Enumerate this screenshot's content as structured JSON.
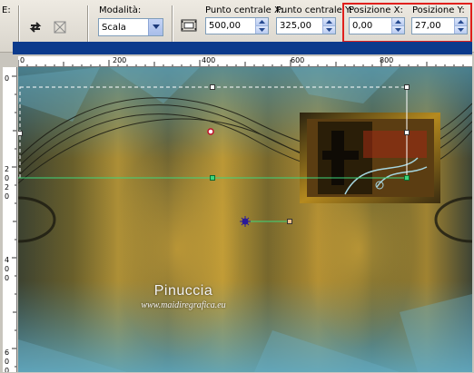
{
  "toolbar": {
    "cut_label": "E:",
    "mode_label": "Modalità:",
    "mode_value": "Scala",
    "center_x_label": "Punto centrale X:",
    "center_x_value": "500,00",
    "center_y_label": "Punto centrale Y:",
    "center_y_value": "325,00",
    "pos_x_label": "Posizione X:",
    "pos_x_value": "0,00",
    "pos_y_label": "Posizione Y:",
    "pos_y_value": "27,00",
    "highlight_color": "#e0201c"
  },
  "rulers": {
    "top": [
      "0",
      "200",
      "400",
      "600",
      "800"
    ],
    "left": [
      "0",
      "2",
      "0",
      "2",
      "0",
      "4",
      "0",
      "0",
      "6",
      "0",
      "0"
    ]
  },
  "watermark": {
    "name": "Pinuccia",
    "url": "www.maidiregrafica.eu"
  },
  "colors": {
    "accent": "#0b3a8c",
    "image_gold": "#b48a1c",
    "image_teal": "#4a8aa0",
    "selection_handle": "#3dd67a"
  }
}
